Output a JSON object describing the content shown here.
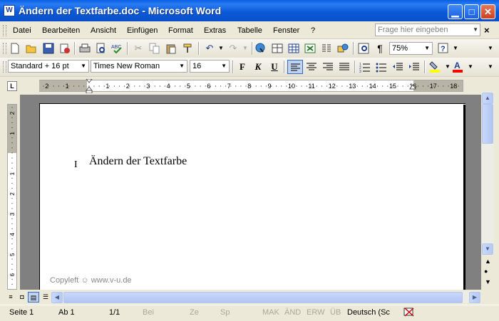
{
  "window": {
    "title": "Ändern der Textfarbe.doc - Microsoft Word",
    "app_icon": "W",
    "controls": {
      "minimize": "▁",
      "maximize": "□",
      "close": "✕"
    }
  },
  "menu": {
    "items": [
      "Datei",
      "Bearbeiten",
      "Ansicht",
      "Einfügen",
      "Format",
      "Extras",
      "Tabelle",
      "Fenster",
      "?"
    ],
    "help_placeholder": "Frage hier eingeben",
    "doc_close": "×"
  },
  "standard_toolbar": {
    "zoom": "75%"
  },
  "format_toolbar": {
    "style": "Standard + 16 pt",
    "font": "Times New Roman",
    "size": "16",
    "bold": "F",
    "italic": "K",
    "underline": "U",
    "font_color_glyph": "A"
  },
  "ruler": {
    "corner": "L",
    "marks": [
      "2",
      "1",
      "1",
      "2",
      "3",
      "4",
      "5",
      "6",
      "7",
      "8",
      "9",
      "10",
      "11",
      "12",
      "13",
      "14",
      "15",
      "16",
      "17",
      "18"
    ],
    "vmarks": [
      "2",
      "1",
      "1",
      "2",
      "3",
      "4",
      "5",
      "6"
    ]
  },
  "document": {
    "text": "Ändern der Textfarbe",
    "watermark": "Copyleft ☺ www.v-u.de"
  },
  "status": {
    "page": "Seite  1",
    "section": "Ab  1",
    "pages": "1/1",
    "at": "Bei",
    "line": "Ze",
    "column": "Sp",
    "macro": "MAK",
    "track": "ÄND",
    "extend": "ERW",
    "overtype": "ÜB",
    "language": "Deutsch (Sc"
  },
  "colors": {
    "title_bar": "#0a5fe6",
    "chrome": "#ece9d8",
    "workspace": "#808080",
    "highlight": "#ffff00",
    "font_color": "#ff0000"
  }
}
